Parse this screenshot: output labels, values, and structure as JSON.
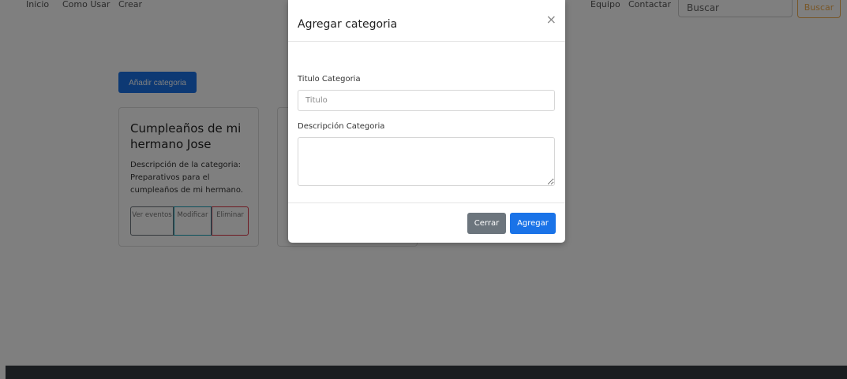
{
  "navbar": {
    "items": [
      "Inicio",
      "Como Usar",
      "Crear",
      "Equipo",
      "Contactar"
    ],
    "search_placeholder": "Buscar",
    "search_button": "Buscar"
  },
  "main": {
    "add_button": "Añadir categoria",
    "cards": [
      {
        "title": "Cumpleaños de mi hermano Jose",
        "description": "Descripción de la categoria: Preparativos para el cumpleaños de mi hermano.",
        "actions": [
          "Ver eventos",
          "Modificar",
          "Eliminar"
        ]
      }
    ]
  },
  "modal": {
    "title": "Agregar categoria",
    "close_icon": "×",
    "fields": {
      "title_label": "Titulo Categoria",
      "title_placeholder": "Titulo",
      "description_label": "Descripción Categoria",
      "description_value": ""
    },
    "buttons": {
      "close": "Cerrar",
      "add": "Agregar"
    }
  },
  "colors": {
    "primary": "#1a73e8",
    "secondary": "#6c757d",
    "warning": "#f0ad4e",
    "info": "#17a2b8",
    "danger": "#dc3545",
    "footer": "#343a40"
  }
}
